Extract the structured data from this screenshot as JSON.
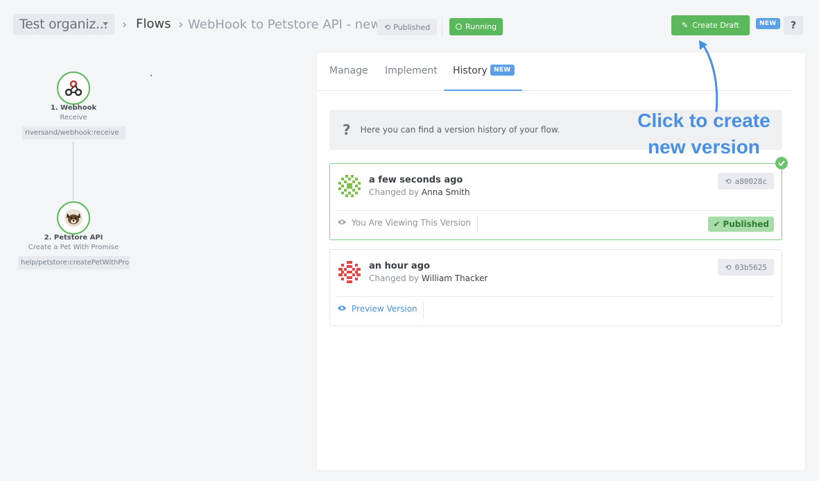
{
  "header": {
    "org": "Test organiz...",
    "crumb_flows": "Flows",
    "flow_name": "WebHook to Petstore API - new",
    "published_badge": "Published",
    "running_badge": "Running",
    "create_draft": "Create Draft",
    "new_tag": "NEW",
    "help": "?"
  },
  "flow": {
    "steps": [
      {
        "title": "1. Webhook",
        "subtitle": "Receive",
        "code": "riversand/webhook:receive"
      },
      {
        "title": "2. Petstore API",
        "subtitle": "Create a Pet With Promise",
        "code": "help/petstore:createPetWithPro"
      }
    ]
  },
  "panel": {
    "tabs": [
      "Manage",
      "Implement",
      "History"
    ],
    "active_tab": "History",
    "history_new_tag": "NEW",
    "info_text": "Here you can find a version history of your flow.",
    "versions": [
      {
        "time": "a few seconds ago",
        "changed_by_label": "Changed by",
        "author": "Anna Smith",
        "hash": "a80028c",
        "action": "You Are Viewing This Version",
        "status": "Published"
      },
      {
        "time": "an hour ago",
        "changed_by_label": "Changed by",
        "author": "William Thacker",
        "hash": "03b5625",
        "action": "Preview Version"
      }
    ]
  },
  "annotation": {
    "line1": "Click to create",
    "line2": "new version"
  },
  "colors": {
    "green": "#5cb85c",
    "blue": "#5b9fe6",
    "annotation_blue": "#4a90e2"
  }
}
